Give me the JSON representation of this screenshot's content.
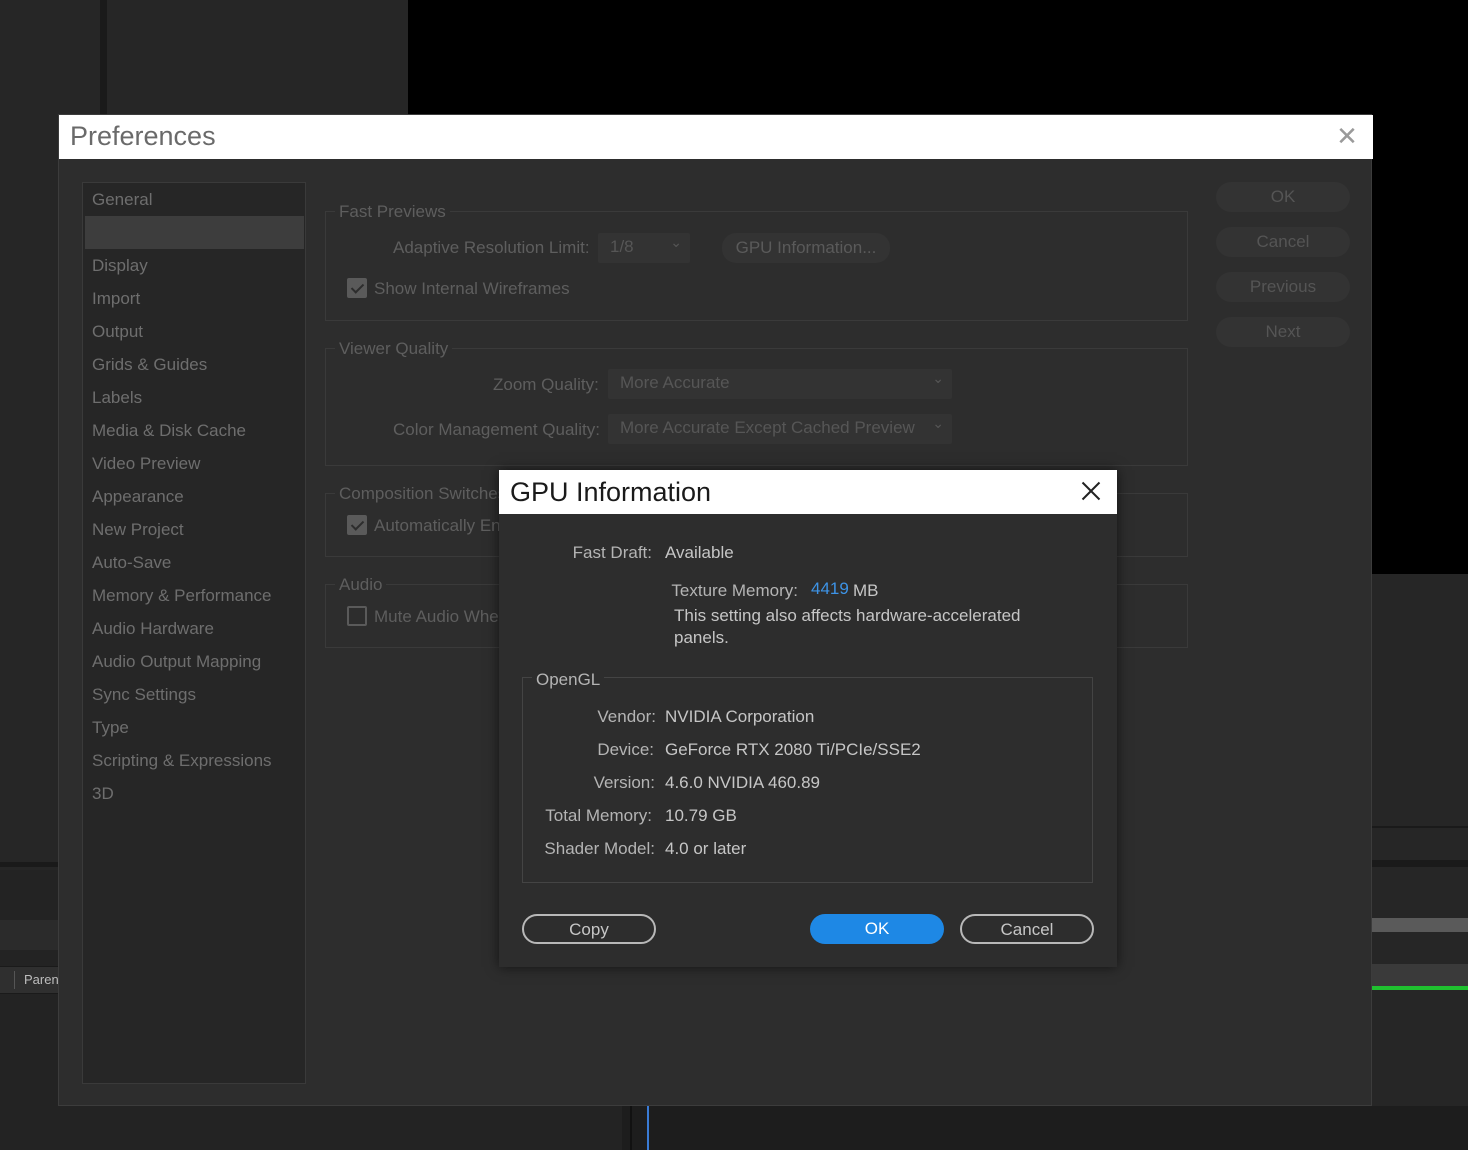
{
  "background": {
    "timeline_tab_label": "Paren"
  },
  "preferences": {
    "title": "Preferences",
    "sidebar": {
      "items": [
        {
          "label": "General"
        },
        {
          "label": ""
        },
        {
          "label": "Display"
        },
        {
          "label": "Import"
        },
        {
          "label": "Output"
        },
        {
          "label": "Grids & Guides"
        },
        {
          "label": "Labels"
        },
        {
          "label": "Media & Disk Cache"
        },
        {
          "label": "Video Preview"
        },
        {
          "label": "Appearance"
        },
        {
          "label": "New Project"
        },
        {
          "label": "Auto-Save"
        },
        {
          "label": "Memory & Performance"
        },
        {
          "label": "Audio Hardware"
        },
        {
          "label": "Audio Output Mapping"
        },
        {
          "label": "Sync Settings"
        },
        {
          "label": "Type"
        },
        {
          "label": "Scripting & Expressions"
        },
        {
          "label": "3D"
        }
      ],
      "selected_index": 1
    },
    "fast_previews": {
      "title": "Fast Previews",
      "adaptive_label": "Adaptive Resolution Limit:",
      "adaptive_value": "1/8",
      "gpu_info_button": "GPU Information...",
      "show_wireframes_label": "Show Internal Wireframes",
      "show_wireframes_checked": true
    },
    "viewer_quality": {
      "title": "Viewer Quality",
      "zoom_label": "Zoom Quality:",
      "zoom_value": "More Accurate",
      "color_label": "Color Management Quality:",
      "color_value": "More Accurate Except Cached Preview"
    },
    "composition_switches": {
      "title": "Composition Switches",
      "auto_label": "Automatically En",
      "auto_checked": true
    },
    "audio": {
      "title": "Audio",
      "mute_label": "Mute Audio Whe",
      "mute_checked": false
    },
    "buttons": {
      "ok": "OK",
      "cancel": "Cancel",
      "previous": "Previous",
      "next": "Next"
    }
  },
  "gpu_dialog": {
    "title": "GPU Information",
    "fast_draft_label": "Fast Draft:",
    "fast_draft_value": "Available",
    "texture_memory_label": "Texture Memory:",
    "texture_memory_value": "4419",
    "texture_memory_unit": "MB",
    "note": "This setting also affects hardware-accelerated panels.",
    "opengl": {
      "title": "OpenGL",
      "vendor_label": "Vendor:",
      "vendor_value": "NVIDIA Corporation",
      "device_label": "Device:",
      "device_value": "GeForce RTX 2080 Ti/PCIe/SSE2",
      "version_label": "Version:",
      "version_value": "4.6.0 NVIDIA 460.89",
      "total_memory_label": "Total Memory:",
      "total_memory_value": "10.79 GB",
      "shader_model_label": "Shader Model:",
      "shader_model_value": "4.0 or later"
    },
    "buttons": {
      "copy": "Copy",
      "ok": "OK",
      "cancel": "Cancel"
    },
    "colors": {
      "accent": "#1e88e5",
      "value_highlight": "#3d93e6"
    }
  }
}
